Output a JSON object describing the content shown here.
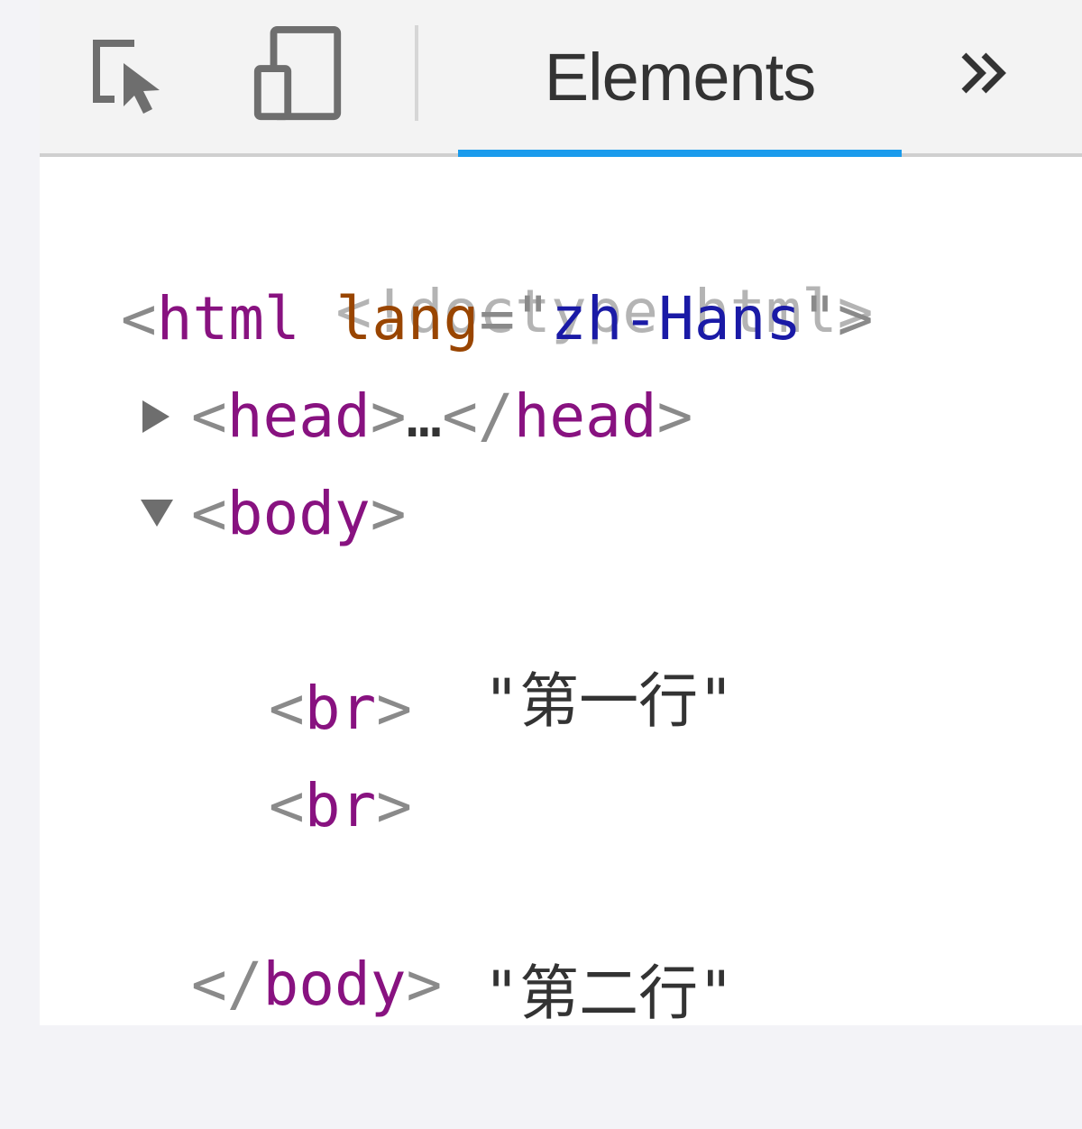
{
  "toolbar": {
    "inspect_icon": "element-picker-icon",
    "device_icon": "device-toolbar-icon",
    "tab_label": "Elements",
    "more_icon": "double-chevron-right-icon",
    "more_label": "»",
    "accent_color": "#1a9bec"
  },
  "dom_tree": {
    "doctype": "<!doctype html>",
    "html_open": {
      "lt": "<",
      "tag": "html",
      "attr_name": "lang",
      "eq_quote": "=\"",
      "attr_value": "zh-Hans",
      "quote_gt": "\">"
    },
    "head": {
      "open_lt": "<",
      "open_tag": "head",
      "open_gt": ">",
      "ellipsis": "…",
      "close_lt": "</",
      "close_tag": "head",
      "close_gt": ">",
      "expanded": false
    },
    "body_open": {
      "lt": "<",
      "tag": "body",
      "gt": ">",
      "expanded": true
    },
    "children": [
      {
        "type": "text",
        "text": "\"第一行\""
      },
      {
        "type": "element",
        "lt": "<",
        "tag": "br",
        "gt": ">"
      },
      {
        "type": "element",
        "lt": "<",
        "tag": "br",
        "gt": ">"
      },
      {
        "type": "text",
        "text": "\"第二行\""
      }
    ],
    "body_close": {
      "lt": "</",
      "tag": "body",
      "gt": ">"
    }
  },
  "syntax_colors": {
    "punctuation": "#8a8a8a",
    "tag": "#881280",
    "attribute": "#994500",
    "value": "#1a1aa6",
    "doctype": "#b4b4b4",
    "text": "#333333"
  }
}
